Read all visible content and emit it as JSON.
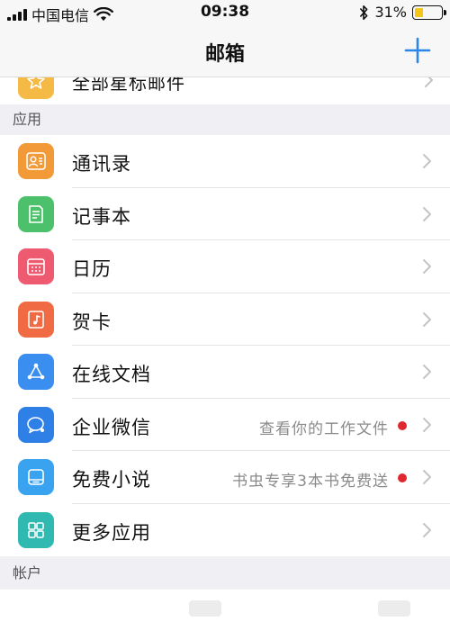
{
  "status_bar": {
    "carrier": "中国电信",
    "time": "09:38",
    "battery_text": "31%",
    "battery_level": 0.31
  },
  "nav": {
    "title": "邮箱",
    "add_icon": "plus-icon"
  },
  "partial_item": {
    "label": "全部星标邮件",
    "icon": "star-icon",
    "color": "#f5b945"
  },
  "sections": {
    "apps": "应用",
    "account": "帐户"
  },
  "items": [
    {
      "label": "通讯录",
      "icon": "contacts-icon",
      "color": "#f29a38",
      "detail": "",
      "dot": false
    },
    {
      "label": "记事本",
      "icon": "notepad-icon",
      "color": "#4cc06a",
      "detail": "",
      "dot": false
    },
    {
      "label": "日历",
      "icon": "calendar-icon",
      "color": "#ee5a6f",
      "detail": "",
      "dot": false
    },
    {
      "label": "贺卡",
      "icon": "greeting-card-icon",
      "color": "#f06a43",
      "detail": "",
      "dot": false
    },
    {
      "label": "在线文档",
      "icon": "share-nodes-icon",
      "color": "#3a8ef0",
      "detail": "",
      "dot": false
    },
    {
      "label": "企业微信",
      "icon": "wework-icon",
      "color": "#2e7fe6",
      "detail": "查看你的工作文件",
      "dot": true
    },
    {
      "label": "免费小说",
      "icon": "book-icon",
      "color": "#3aa3f0",
      "detail": "书虫专享3本书免费送",
      "dot": true
    },
    {
      "label": "更多应用",
      "icon": "grid-icon",
      "color": "#2fb9b1",
      "detail": "",
      "dot": false
    }
  ]
}
